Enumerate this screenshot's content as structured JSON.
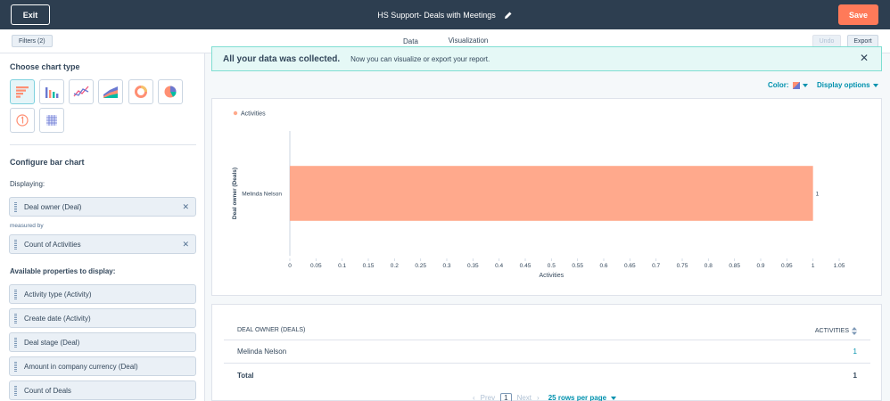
{
  "header": {
    "exit_label": "Exit",
    "title": "HS Support- Deals with Meetings",
    "save_label": "Save"
  },
  "subbar": {
    "filters_label": "Filters (2)",
    "tabs": [
      {
        "label": "Data"
      },
      {
        "label": "Visualization"
      }
    ],
    "active_tab": "Visualization",
    "undo_label": "Undo",
    "export_label": "Export"
  },
  "left": {
    "chart_type_title": "Choose chart type",
    "chart_types": [
      "horizontal-bar",
      "vertical-bar",
      "line",
      "area",
      "donut",
      "pie",
      "summary",
      "table"
    ],
    "selected_chart_type": "horizontal-bar",
    "configure_title": "Configure bar chart",
    "displaying_label": "Displaying:",
    "displaying_value": "Deal owner (Deal)",
    "measured_by_label": "measured by",
    "measured_by_value": "Count of Activities",
    "available_title": "Available properties to display:",
    "available": [
      "Activity type (Activity)",
      "Create date (Activity)",
      "Deal stage (Deal)",
      "Amount in company currency (Deal)",
      "Count of Deals"
    ]
  },
  "banner": {
    "strong": "All your data was collected.",
    "text": "Now you can visualize or export your report."
  },
  "controls": {
    "color_label": "Color:",
    "display_options_label": "Display options"
  },
  "chart_data": {
    "type": "bar",
    "orientation": "horizontal",
    "categories": [
      "Melinda Nelson"
    ],
    "series": [
      {
        "name": "Activities",
        "values": [
          1
        ],
        "color": "#ffa98c"
      }
    ],
    "data_labels": [
      "1"
    ],
    "xlabel": "Activities",
    "ylabel": "Deal owner (Deals)",
    "xlim": [
      0,
      1.05
    ],
    "xticks": [
      "0",
      "0.05",
      "0.1",
      "0.15",
      "0.2",
      "0.25",
      "0.3",
      "0.35",
      "0.4",
      "0.45",
      "0.5",
      "0.55",
      "0.6",
      "0.65",
      "0.7",
      "0.75",
      "0.8",
      "0.85",
      "0.9",
      "0.95",
      "1",
      "1.05"
    ],
    "legend": "top-left",
    "grid": false
  },
  "table": {
    "columns": [
      "DEAL OWNER (DEALS)",
      "ACTIVITIES"
    ],
    "rows": [
      {
        "owner": "Melinda Nelson",
        "activities": "1"
      }
    ],
    "total_label": "Total",
    "total_value": "1"
  },
  "pagination": {
    "prev_label": "Prev",
    "page": "1",
    "next_label": "Next",
    "rows_per_page_label": "25 rows per page"
  }
}
